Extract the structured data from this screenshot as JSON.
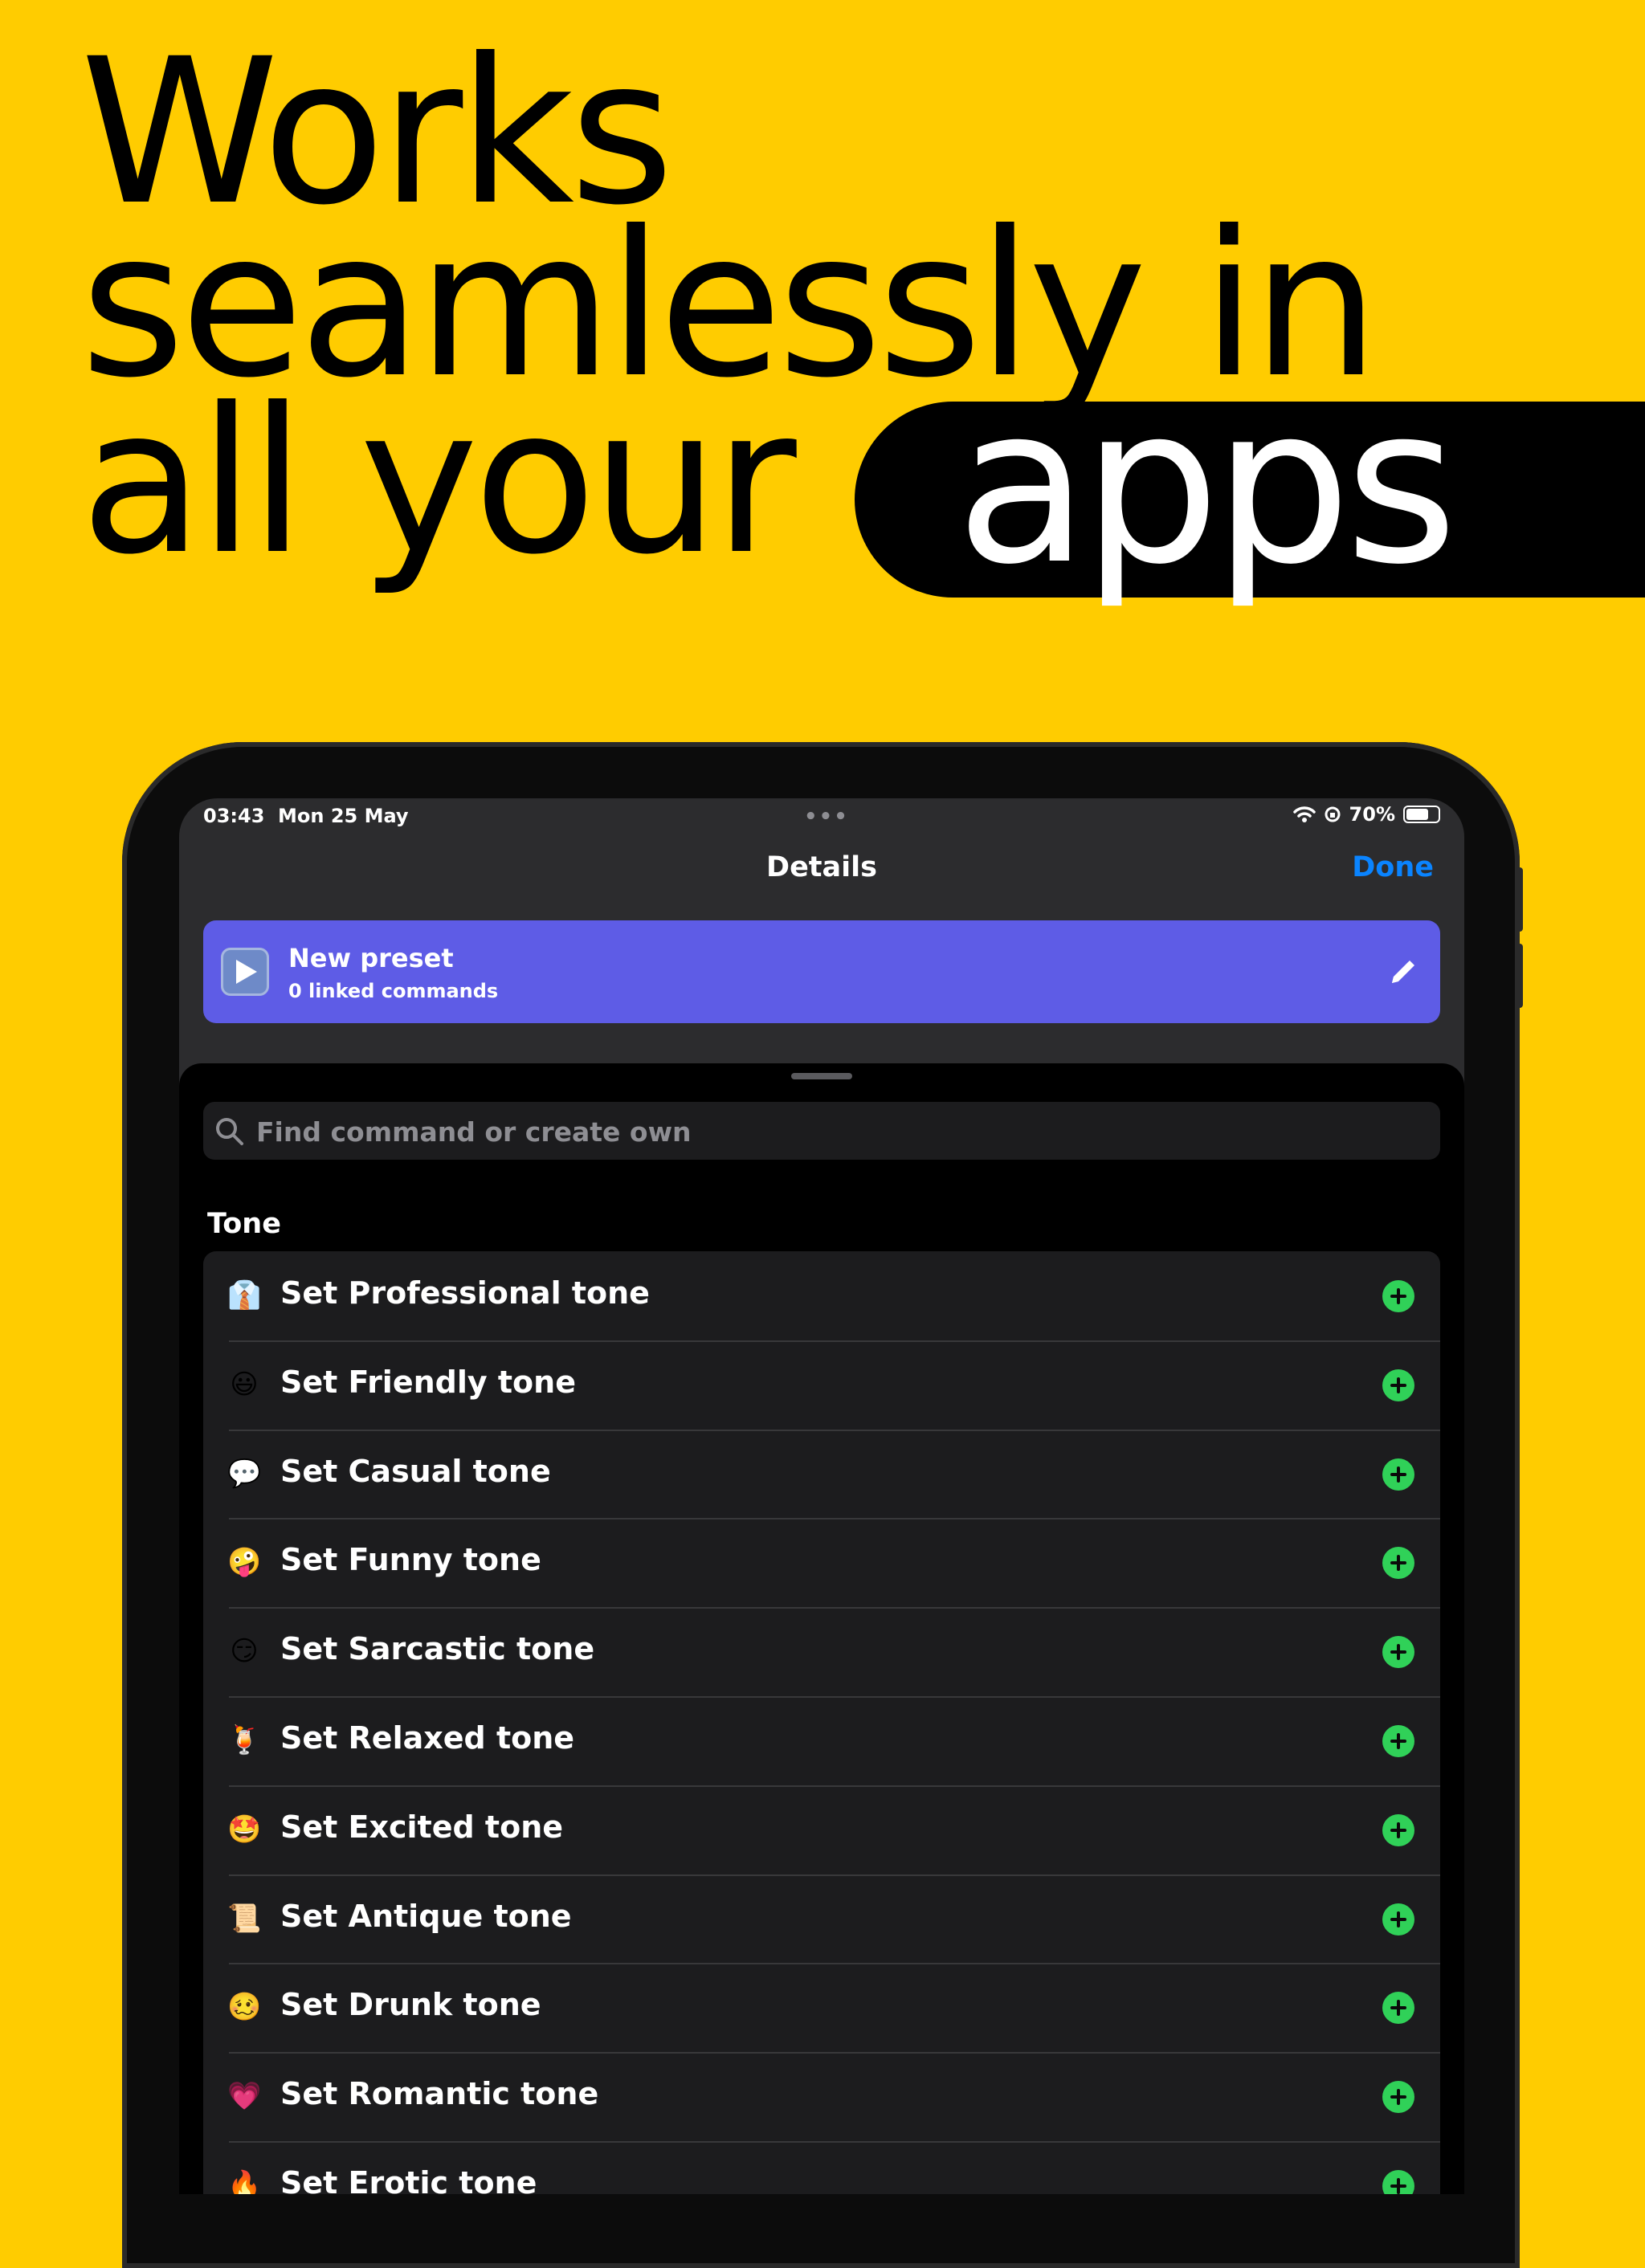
{
  "headline": {
    "line1": "Works",
    "line2": "seamlessly in",
    "line3": "all your",
    "highlight": "apps"
  },
  "status_bar": {
    "time": "03:43",
    "date": "Mon 25 May",
    "battery": "70%",
    "battery_level": 0.7,
    "icons": [
      "wifi-icon",
      "orientation-lock-icon",
      "battery-icon"
    ]
  },
  "nav": {
    "title": "Details",
    "done_label": "Done"
  },
  "preset": {
    "title": "New preset",
    "subtitle": "0 linked commands",
    "icon": "play-icon",
    "edit_icon": "pencil-icon"
  },
  "search": {
    "placeholder": "Find command or create own"
  },
  "section": {
    "title": "Tone"
  },
  "commands": [
    {
      "emoji": "👔",
      "label": "Set Professional tone"
    },
    {
      "emoji": "😃",
      "label": "Set Friendly tone"
    },
    {
      "emoji": "💬",
      "label": "Set Casual tone"
    },
    {
      "emoji": "🤪",
      "label": "Set Funny tone"
    },
    {
      "emoji": "😏",
      "label": "Set Sarcastic tone"
    },
    {
      "emoji": "🍹",
      "label": "Set Relaxed tone"
    },
    {
      "emoji": "🤩",
      "label": "Set Excited tone"
    },
    {
      "emoji": "📜",
      "label": "Set Antique tone"
    },
    {
      "emoji": "🥴",
      "label": "Set Drunk tone"
    },
    {
      "emoji": "💗",
      "label": "Set Romantic tone"
    },
    {
      "emoji": "🔥",
      "label": "Set Erotic tone"
    }
  ],
  "colors": {
    "background": "#FFCC00",
    "accent_blue": "#0A84FF",
    "preset_purple": "#5E5CE6",
    "add_green": "#30D158"
  }
}
